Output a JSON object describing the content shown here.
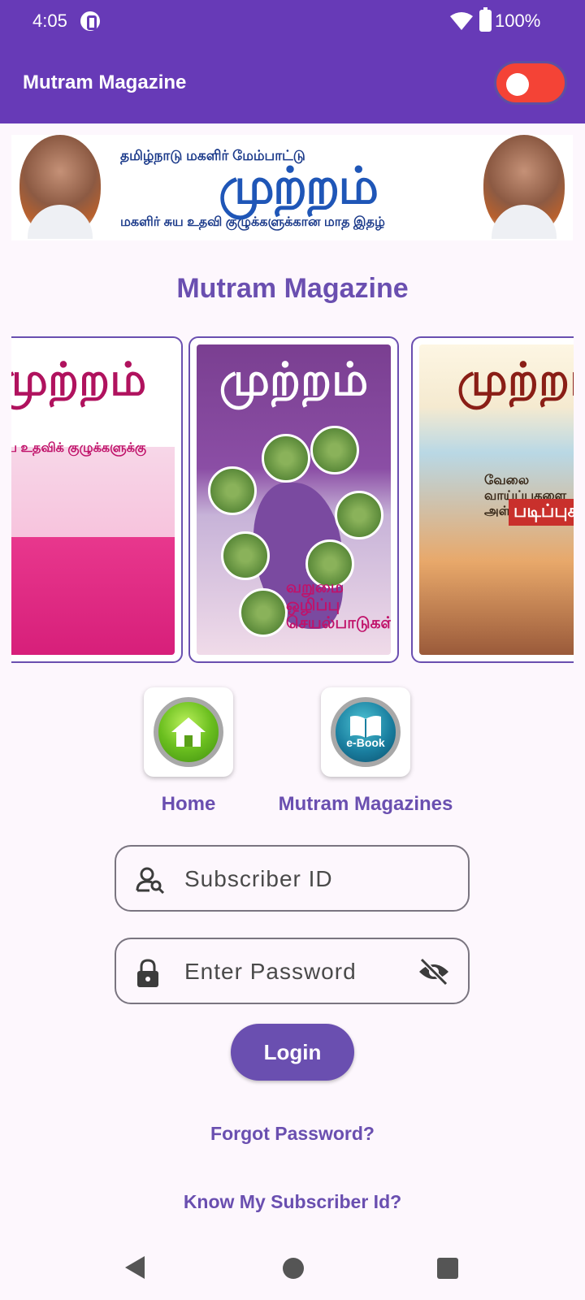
{
  "status_bar": {
    "time": "4:05",
    "battery": "100%"
  },
  "app_bar": {
    "title": "Mutram Magazine",
    "toggle_state": "off"
  },
  "banner": {
    "top_text": "தமிழ்நாடு மகளிர் மேம்பாட்டு",
    "logo_text": "முற்றம்",
    "bottom_text": "மகளிர் சுய உதவி குழுக்களுக்கான மாத இதழ்"
  },
  "section_title": "Mutram Magazine",
  "covers": [
    {
      "title": "முற்றம்",
      "subtitle": "சுய உதவிக் குழுக்களுக்கு"
    },
    {
      "title": "முற்றம்",
      "subtitle": "வறுமை ஒழிப்பு செயல்பாடுகள்"
    },
    {
      "title": "முற்றம்",
      "subtitle": "வேலை வாய்ப்புகளை அள்ளித் தரும்",
      "subtitle2": "படிப்புகள்"
    }
  ],
  "nav": {
    "home_label": "Home",
    "magazines_label": "Mutram Magazines",
    "ebook_text": "e-Book"
  },
  "form": {
    "subscriber_placeholder": "Subscriber ID",
    "password_placeholder": "Enter Password",
    "login_label": "Login"
  },
  "links": {
    "forgot_password": "Forgot Password?",
    "know_subscriber_id": "Know My Subscriber Id?"
  },
  "colors": {
    "primary": "#673ab7",
    "accent_text": "#6a4fb0",
    "toggle_off": "#f44336",
    "background": "#fdf7fd"
  },
  "icons": [
    "wifi-icon",
    "battery-icon",
    "home-icon",
    "ebook-icon",
    "user-search-icon",
    "lock-icon",
    "eye-off-icon"
  ]
}
